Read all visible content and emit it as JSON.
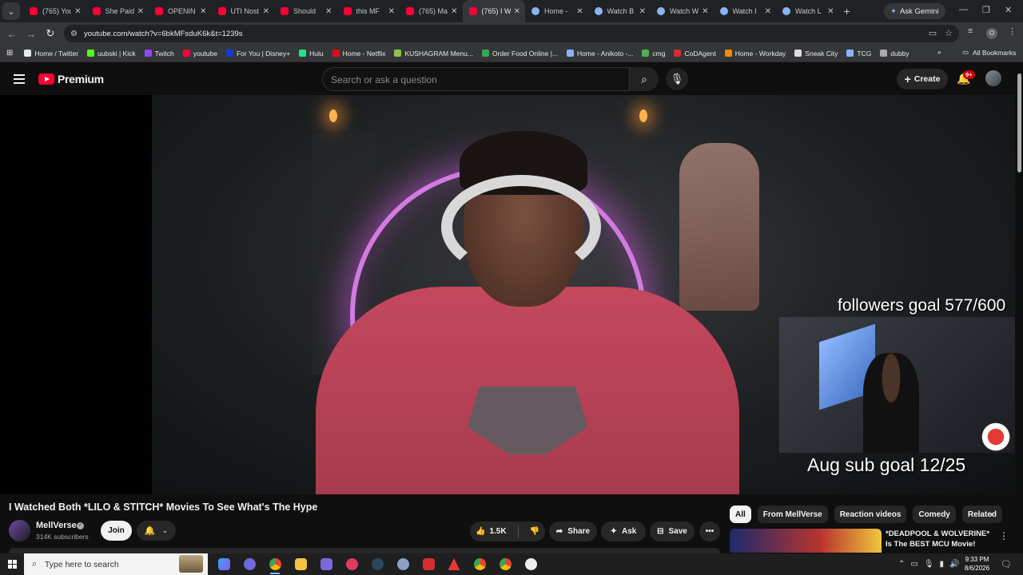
{
  "browser": {
    "tabs": [
      {
        "label": "(765) You",
        "favicon": "youtube-icon"
      },
      {
        "label": "She Paid",
        "favicon": "youtube-icon"
      },
      {
        "label": "OPENIN",
        "favicon": "youtube-icon"
      },
      {
        "label": "UTI Nost",
        "favicon": "youtube-icon"
      },
      {
        "label": "Should",
        "favicon": "youtube-icon"
      },
      {
        "label": "this MF",
        "favicon": "youtube-icon"
      },
      {
        "label": "(765) Ma",
        "favicon": "youtube-icon"
      },
      {
        "label": "(765) I W",
        "favicon": "youtube-icon",
        "active": true
      },
      {
        "label": "Home -",
        "favicon": "globe-icon"
      },
      {
        "label": "Watch B",
        "favicon": "globe-icon"
      },
      {
        "label": "Watch W",
        "favicon": "globe-icon"
      },
      {
        "label": "Watch I",
        "favicon": "globe-icon"
      },
      {
        "label": "Watch L",
        "favicon": "globe-icon"
      }
    ],
    "new_tab": "+",
    "gemini_label": "Ask Gemini",
    "url": "youtube.com/watch?v=6bkMFsduK6k&t=1239s",
    "profile_letter": "O",
    "bookmarks": [
      {
        "label": "Home / Twitter",
        "color": "#e7e9ea"
      },
      {
        "label": "uubski | Kick",
        "color": "#53fc18"
      },
      {
        "label": "Twitch",
        "color": "#9146ff"
      },
      {
        "label": "youtube",
        "color": "#ff0033"
      },
      {
        "label": "For You | Disney+",
        "color": "#113ccf"
      },
      {
        "label": "Hulu",
        "color": "#1ce783"
      },
      {
        "label": "Home - Netflix",
        "color": "#e50914"
      },
      {
        "label": "KUSHAGRAM Menu...",
        "color": "#8bc34a"
      },
      {
        "label": "Order Food Online |...",
        "color": "#34a853"
      },
      {
        "label": "Home - Anikoto -...",
        "color": "#8ab4f8"
      },
      {
        "label": "cmg",
        "color": "#4caf50"
      },
      {
        "label": "CoDAgent",
        "color": "#d32f2f"
      },
      {
        "label": "Home - Workday",
        "color": "#f38b00"
      },
      {
        "label": "Sneak City",
        "color": "#dddddd"
      },
      {
        "label": "TCG",
        "color": "#8ab4f8"
      },
      {
        "label": "dubby",
        "color": "#aaaaaa"
      }
    ],
    "all_bookmarks": "All Bookmarks"
  },
  "youtube": {
    "logo_text": "Premium",
    "search_placeholder": "Search or ask a question",
    "create_label": "Create",
    "notification_count": "9+",
    "video": {
      "overlay_followers": "followers goal 577/600",
      "overlay_sub_goal": "Aug sub goal 12/25"
    },
    "title": "I Watched Both *LILO & STITCH* Movies To See What's The Hype",
    "channel": {
      "name": "MellVerse",
      "subscribers": "314K subscribers"
    },
    "join_label": "Join",
    "likes": "1.5K",
    "share_label": "Share",
    "ask_label": "Ask",
    "save_label": "Save",
    "chips": [
      "All",
      "From MellVerse",
      "Reaction videos",
      "Comedy",
      "Related"
    ],
    "recommendation": {
      "title": "*DEADPOOL & WOLVERINE* Is The BEST MCU Movie!"
    }
  },
  "taskbar": {
    "search_placeholder": "Type here to search",
    "time": "9:33 PM",
    "date": "8/6/2026"
  },
  "colors": {
    "accent": "#ff0033",
    "background": "#0f0f0f"
  }
}
